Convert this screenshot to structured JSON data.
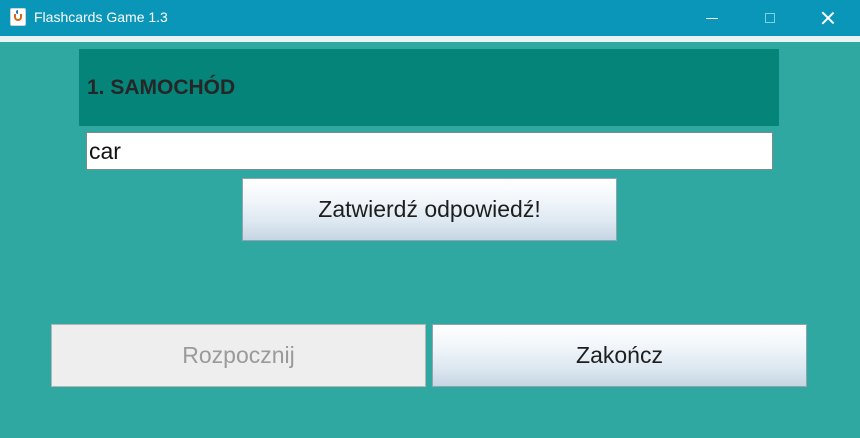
{
  "window": {
    "title": "Flashcards Game 1.3",
    "accent_color": "#0a96b8",
    "background_color": "#2ea8a0"
  },
  "question": {
    "label": "1. SAMOCHÓD",
    "panel_color": "#05847a"
  },
  "answer_field": {
    "value": "car"
  },
  "buttons": {
    "submit_label": "Zatwierdź odpowiedź!",
    "start_label": "Rozpocznij",
    "start_enabled": false,
    "end_label": "Zakończ"
  },
  "icons": {
    "app": "java-cup-icon",
    "minimize": "minimize-icon",
    "maximize": "maximize-icon",
    "close": "close-icon"
  }
}
